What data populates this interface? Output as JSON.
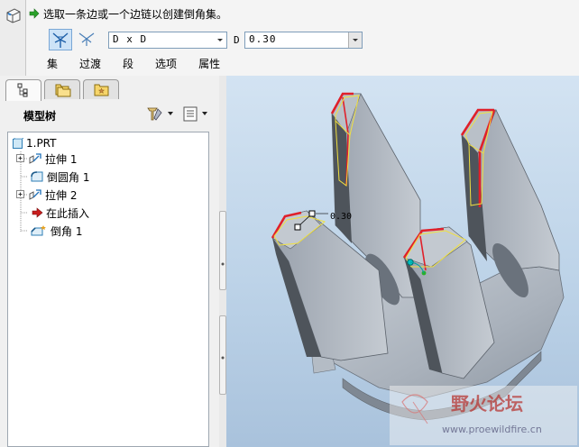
{
  "dashboard": {
    "prompt": "选取一条边或一个边链以创建倒角集。",
    "scheme": "D x D",
    "d_label": "D",
    "d_value": "0.30",
    "tabs": [
      "集",
      "过渡",
      "段",
      "选项",
      "属性"
    ]
  },
  "navigator": {
    "tree_title": "模型树",
    "tree": [
      {
        "label": "1.PRT",
        "icon": "part-icon",
        "expandable": false
      },
      {
        "label": "拉伸 1",
        "icon": "extrude-icon",
        "expandable": true
      },
      {
        "label": "倒圆角 1",
        "icon": "round-icon",
        "expandable": false
      },
      {
        "label": "拉伸 2",
        "icon": "extrude-icon",
        "expandable": true
      },
      {
        "label": "在此插入",
        "icon": "insert-here-arrow-icon",
        "expandable": false
      },
      {
        "label": "倒角 1",
        "icon": "chamfer-icon",
        "expandable": false
      }
    ]
  },
  "graphics": {
    "dimension_label": "0.30"
  },
  "watermark": {
    "name": "野火论坛",
    "url": "www.proewildfire.cn"
  },
  "colors": {
    "selected_edge": "#e0202a",
    "preview_geometry": "#f0e040",
    "handle": "#00c0c0",
    "prompt_arrow": "#2aa12a",
    "insert_arrow": "#c81e1e"
  }
}
